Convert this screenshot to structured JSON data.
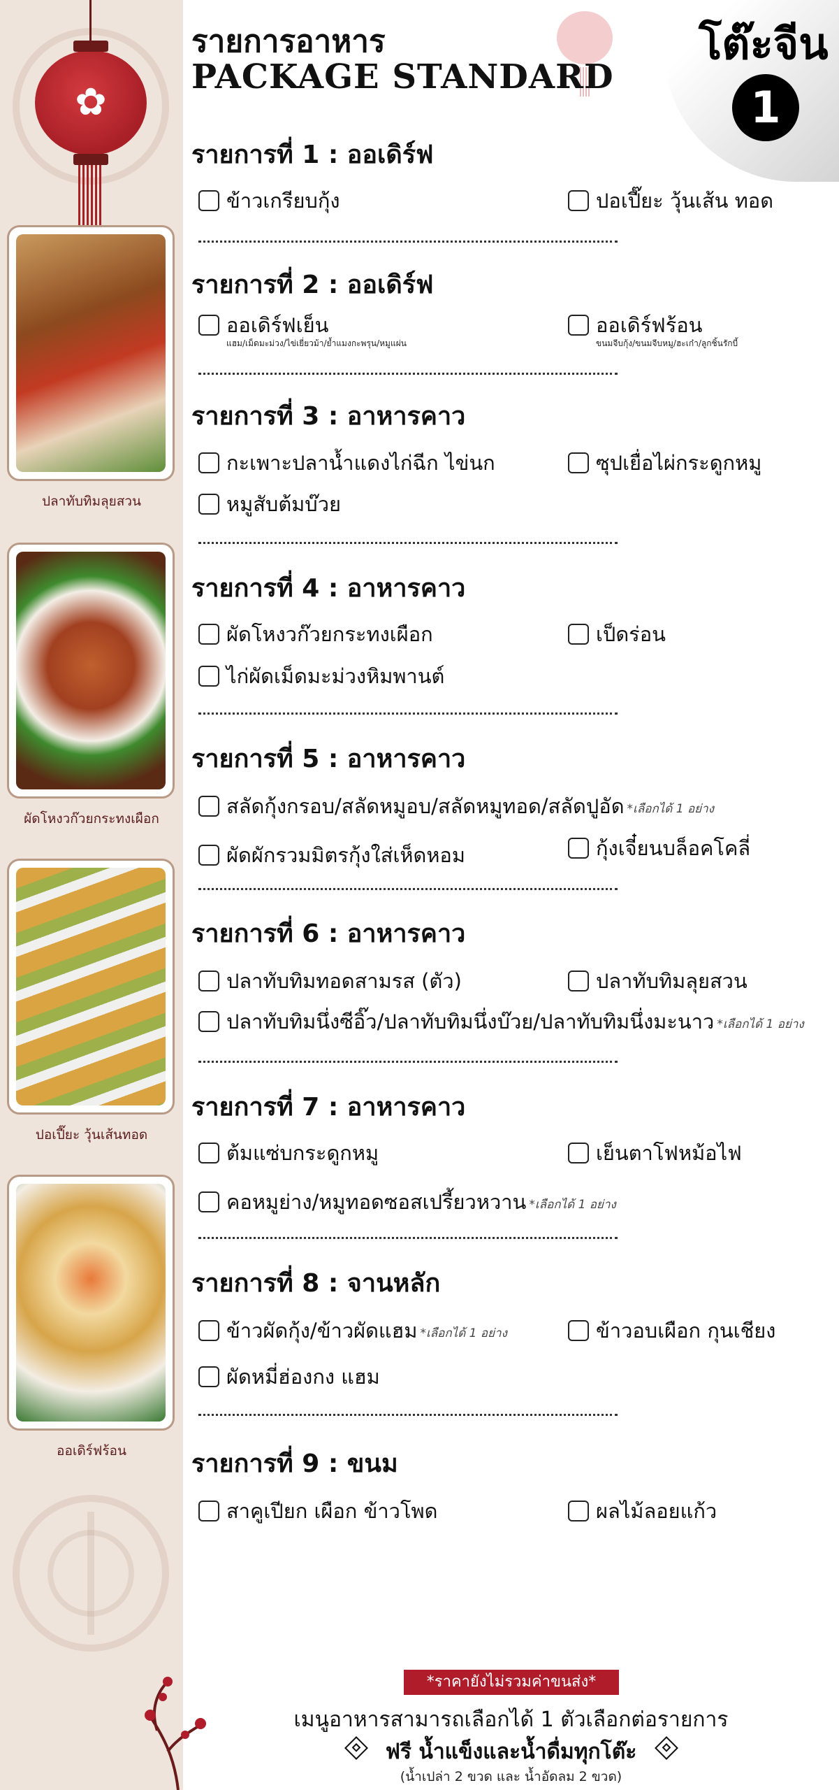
{
  "header": {
    "title": "รายการอาหาร",
    "subtitle": "PACKAGE STANDARD",
    "table_type": "โต๊ะจีน",
    "table_number": "1"
  },
  "sidebar": {
    "captions": [
      "ปลาทับทิมลุยสวน",
      "ผัดโหงวก๊วยกระทงเผือก",
      "ปอเปี๊ยะ วุ้นเส้นทอด",
      "ออเดิร์ฟร้อน"
    ]
  },
  "sections": [
    {
      "title": "รายการที่ 1 : ออเดิร์ฟ",
      "items": [
        {
          "label": "ข้าวเกรียบกุ้ง"
        },
        {
          "label": "ปอเปี๊ยะ วุ้นเส้น ทอด"
        }
      ]
    },
    {
      "title": "รายการที่ 2 : ออเดิร์ฟ",
      "items": [
        {
          "label": "ออเดิร์ฟเย็น",
          "sub": "แฮม/เม็ดมะม่วง/ไข่เยี่ยวม้า/ย้ำแมงกะพรุน/หมูแผ่น"
        },
        {
          "label": "ออเดิร์ฟร้อน",
          "sub": "ขนมจีบกุ้ง/ขนมจีบหมู/ฮะเก๋า/ลูกชิ้นรักบี้"
        }
      ]
    },
    {
      "title": "รายการที่ 3 : อาหารคาว",
      "items": [
        {
          "label": "กะเพาะปลาน้ำแดงไก่ฉีก ไข่นก"
        },
        {
          "label": "ซุปเยื่อไผ่กระดูกหมู"
        },
        {
          "label": "หมูสับต้มบ๊วย"
        }
      ]
    },
    {
      "title": "รายการที่ 4 : อาหารคาว",
      "items": [
        {
          "label": "ผัดโหงวก๊วยกระทงเผือก"
        },
        {
          "label": "เป็ดร่อน"
        },
        {
          "label": "ไก่ผัดเม็ดมะม่วงหิมพานต์"
        }
      ]
    },
    {
      "title": "รายการที่ 5 : อาหารคาว",
      "items": [
        {
          "label": "สลัดกุ้งกรอบ/สลัดหมูอบ/สลัดหมูทอด/สลัดปูอัด",
          "note": "*เลือกได้ 1 อย่าง"
        },
        {
          "label": "ผัดผักรวมมิตรกุ้งใส่เห็ดหอม"
        },
        {
          "label": "กุ้งเจี๋ยนบล็อคโคลี่"
        }
      ]
    },
    {
      "title": "รายการที่ 6 : อาหารคาว",
      "items": [
        {
          "label": "ปลาทับทิมทอดสามรส (ตัว)"
        },
        {
          "label": "ปลาทับทิมลุยสวน"
        },
        {
          "label": "ปลาทับทิมนึ่งซีอิ๊ว/ปลาทับทิมนึ่งบ๊วย/ปลาทับทิมนึ่งมะนาว",
          "note": "*เลือกได้ 1 อย่าง"
        }
      ]
    },
    {
      "title": "รายการที่ 7 : อาหารคาว",
      "items": [
        {
          "label": "ต้มแซ่บกระดูกหมู"
        },
        {
          "label": "เย็นตาโฟหม้อไฟ"
        },
        {
          "label": "คอหมูย่าง/หมูทอดซอสเปรี้ยวหวาน",
          "note": "*เลือกได้ 1 อย่าง"
        }
      ]
    },
    {
      "title": "รายการที่ 8 : จานหลัก",
      "items": [
        {
          "label": "ข้าวผัดกุ้ง/ข้าวผัดแฮม",
          "note": "*เลือกได้ 1 อย่าง"
        },
        {
          "label": "ข้าวอบเผือก กุนเชียง"
        },
        {
          "label": "ผัดหมี่ฮ่องกง แฮม"
        }
      ]
    },
    {
      "title": "รายการที่ 9 : ขนม",
      "items": [
        {
          "label": "สาคูเปียก เผือก ข้าวโพด"
        },
        {
          "label": "ผลไม้ลอยแก้ว"
        }
      ]
    }
  ],
  "footer": {
    "badge": "*ราคายังไม่รวมค่าขนส่ง*",
    "line1": "เมนูอาหารสามารถเลือกได้ 1 ตัวเลือกต่อรายการ",
    "line2": "ฟรี น้ำแข็งและน้ำดื่มทุกโต๊ะ",
    "line3": "(น้ำเปล่า 2 ขวด และ น้ำอัดลม 2 ขวด)"
  }
}
